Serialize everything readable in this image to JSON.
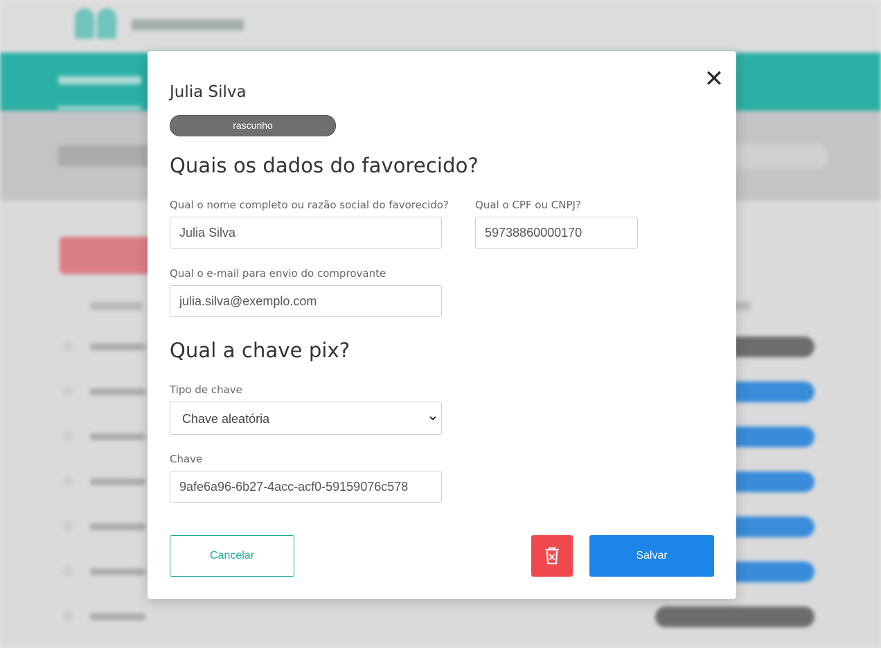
{
  "modal": {
    "close_symbol": "✕",
    "title": "Julia Silva",
    "status": "rascunho",
    "section_favorecido": "Quais os dados do favorecido?",
    "name_label": "Qual o nome completo ou razão social do favorecido?",
    "name_value": "Julia Silva",
    "doc_label": "Qual o CPF ou CNPJ?",
    "doc_value": "59738860000170",
    "email_label": "Qual o e-mail para envio do comprovante",
    "email_value": "julia.silva@exemplo.com",
    "section_pix": "Qual a chave pix?",
    "key_type_label": "Tipo de chave",
    "key_type_selected": "Chave aleatória",
    "key_label": "Chave",
    "key_value": "9afe6a96-6b27-4acc-acf0-59159076c578",
    "cancel_label": "Cancelar",
    "save_label": "Salvar"
  },
  "icons": {
    "close": "close-icon",
    "delete": "trash-icon",
    "dropdown": "chevron-down-icon"
  },
  "colors": {
    "accent_teal": "#1ea99d",
    "primary_blue": "#1c85e8",
    "danger_red": "#f04a4f",
    "badge_gray": "#6f6f6f"
  }
}
